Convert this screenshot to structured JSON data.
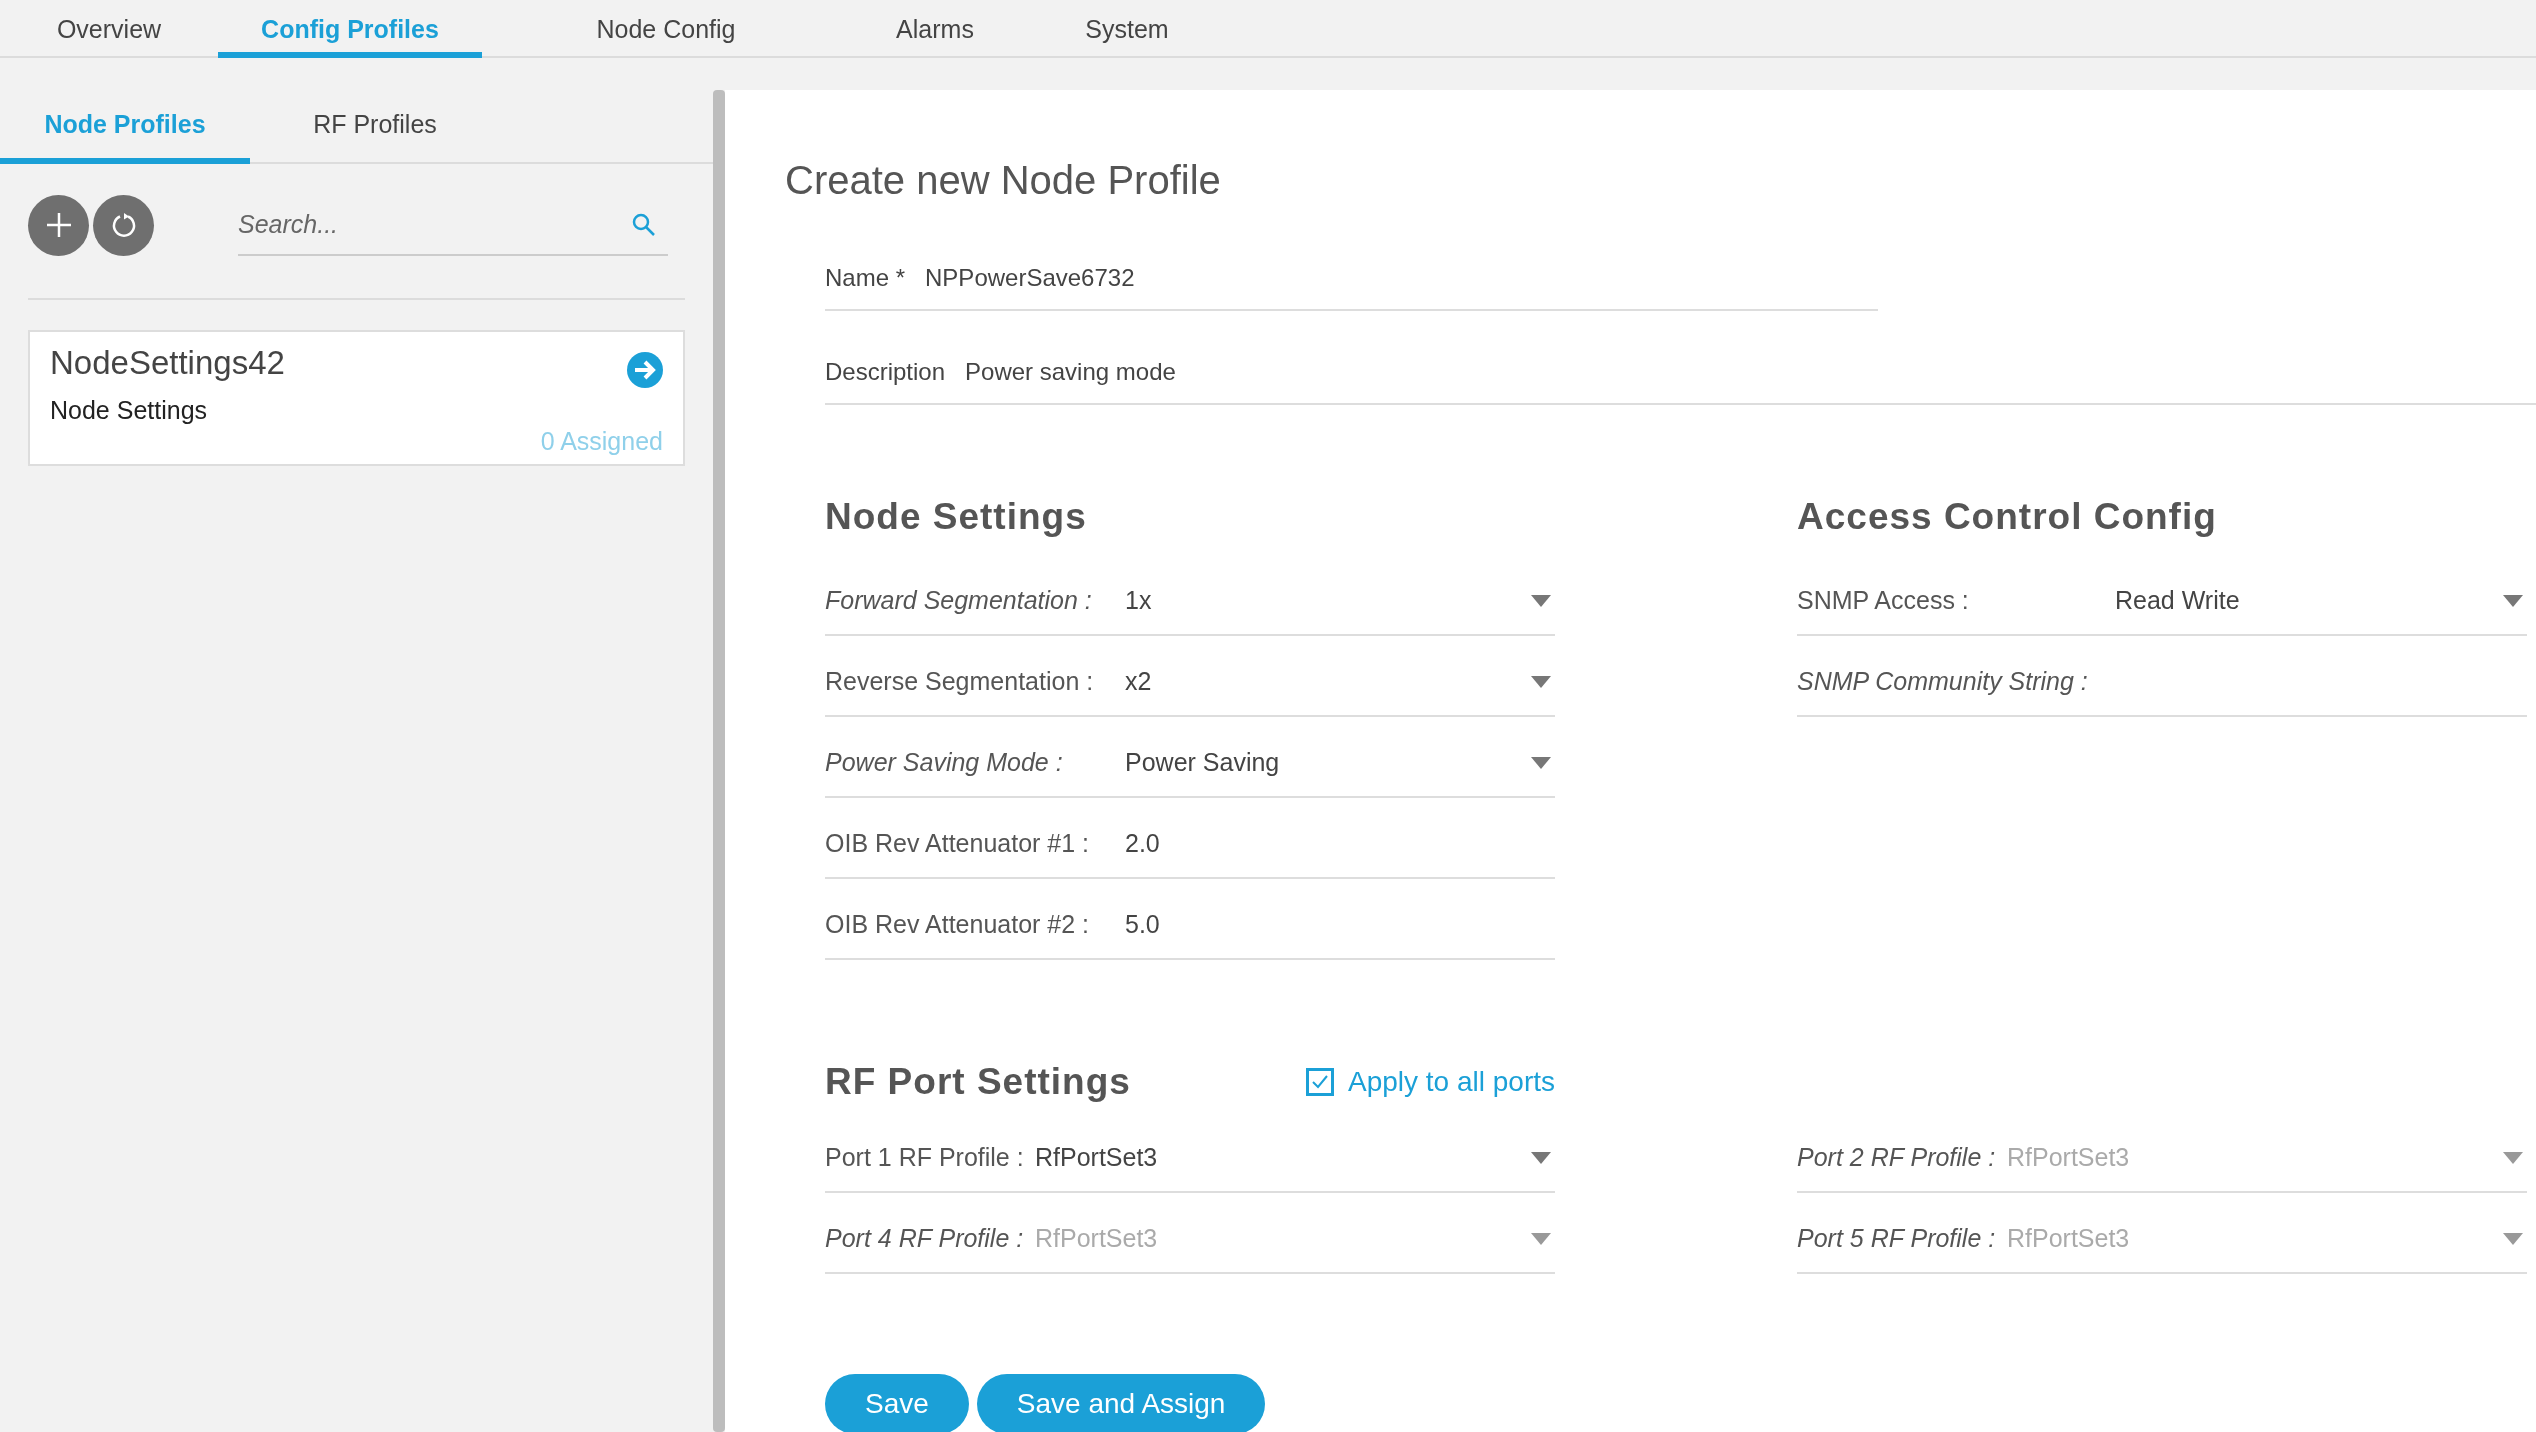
{
  "nav_tabs": [
    {
      "label": "Overview",
      "selected": false
    },
    {
      "label": "Config Profiles",
      "selected": true
    },
    {
      "label": "Node Config",
      "selected": false
    },
    {
      "label": "Alarms",
      "selected": false
    },
    {
      "label": "System",
      "selected": false
    }
  ],
  "sidebar": {
    "tabs": [
      {
        "label": "Node Profiles",
        "selected": true
      },
      {
        "label": "RF Profiles",
        "selected": false
      }
    ],
    "search": {
      "placeholder": "Search..."
    },
    "profiles": [
      {
        "name": "NodeSettings42",
        "type": "Node Settings",
        "assigned": "0 Assigned"
      }
    ]
  },
  "form": {
    "title": "Create new Node Profile",
    "name": {
      "label": "Name *",
      "value": "NPPowerSave6732"
    },
    "description": {
      "label": "Description",
      "value": "Power saving mode"
    },
    "node_settings": {
      "title": "Node Settings",
      "fields": [
        {
          "kind": "select",
          "label": "Forward Segmentation :",
          "value": "1x",
          "inherited": true,
          "disabled": false
        },
        {
          "kind": "select",
          "label": "Reverse Segmentation :",
          "value": "x2",
          "inherited": false,
          "disabled": false
        },
        {
          "kind": "select",
          "label": "Power Saving Mode :",
          "value": "Power Saving",
          "inherited": true,
          "disabled": false
        },
        {
          "kind": "text",
          "label": "OIB Rev Attenuator #1 :",
          "value": "2.0",
          "inherited": false,
          "disabled": false
        },
        {
          "kind": "text",
          "label": "OIB Rev Attenuator #2 :",
          "value": "5.0",
          "inherited": false,
          "disabled": false
        }
      ]
    },
    "access_control": {
      "title": "Access Control Config",
      "fields": [
        {
          "kind": "select",
          "label": "SNMP Access :",
          "value": "Read Write",
          "inherited": false,
          "disabled": false
        },
        {
          "kind": "text",
          "label": "SNMP Community String :",
          "inherited": true
        }
      ]
    },
    "rf_port_settings": {
      "title": "RF Port Settings",
      "apply_all": {
        "label": "Apply to all ports",
        "checked": true
      },
      "left": [
        {
          "kind": "select",
          "label": "Port 1 RF Profile :",
          "value": "RfPortSet3",
          "inherited": false,
          "disabled": false
        },
        {
          "kind": "select",
          "label": "Port 4 RF Profile :",
          "value": "RfPortSet3",
          "inherited": true,
          "disabled": true
        }
      ],
      "right": [
        {
          "kind": "select",
          "label": "Port 2 RF Profile :",
          "value": "RfPortSet3",
          "inherited": true,
          "disabled": true
        },
        {
          "kind": "select",
          "label": "Port 5 RF Profile :",
          "value": "RfPortSet3",
          "inherited": true,
          "disabled": true
        }
      ]
    },
    "buttons": [
      "Save",
      "Save and Assign"
    ]
  }
}
